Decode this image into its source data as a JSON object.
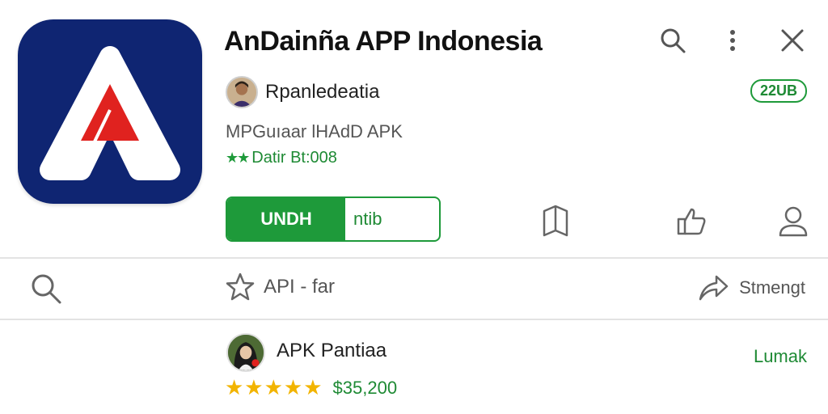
{
  "app": {
    "title": "AnDainña APP Indonesia",
    "developer": "Rpanledeatia",
    "size_badge": "22UB",
    "meta": "MPGuıaar lHAdD APK",
    "rating_stars": "★★",
    "rating_text": "Datir Bt:008",
    "install_primary": "UNDH",
    "install_secondary": "ntib"
  },
  "top_bar": {
    "icons": [
      "search-icon",
      "more-vert-icon",
      "close-icon"
    ]
  },
  "actions": {
    "icons": [
      "bookmark-icon",
      "thumb-like-icon",
      "user-icon"
    ]
  },
  "search_row": {
    "api_label": "API - far",
    "share_label": "Stmengt"
  },
  "list_item": {
    "title": "APK Pantiaa",
    "link": "Lumak",
    "stars": "★★★★★",
    "count": "$35,200"
  },
  "colors": {
    "accent_green": "#1e9a3a",
    "icon_bg": "#0f2572",
    "icon_red": "#e0221f",
    "star_gold": "#f2b400"
  }
}
